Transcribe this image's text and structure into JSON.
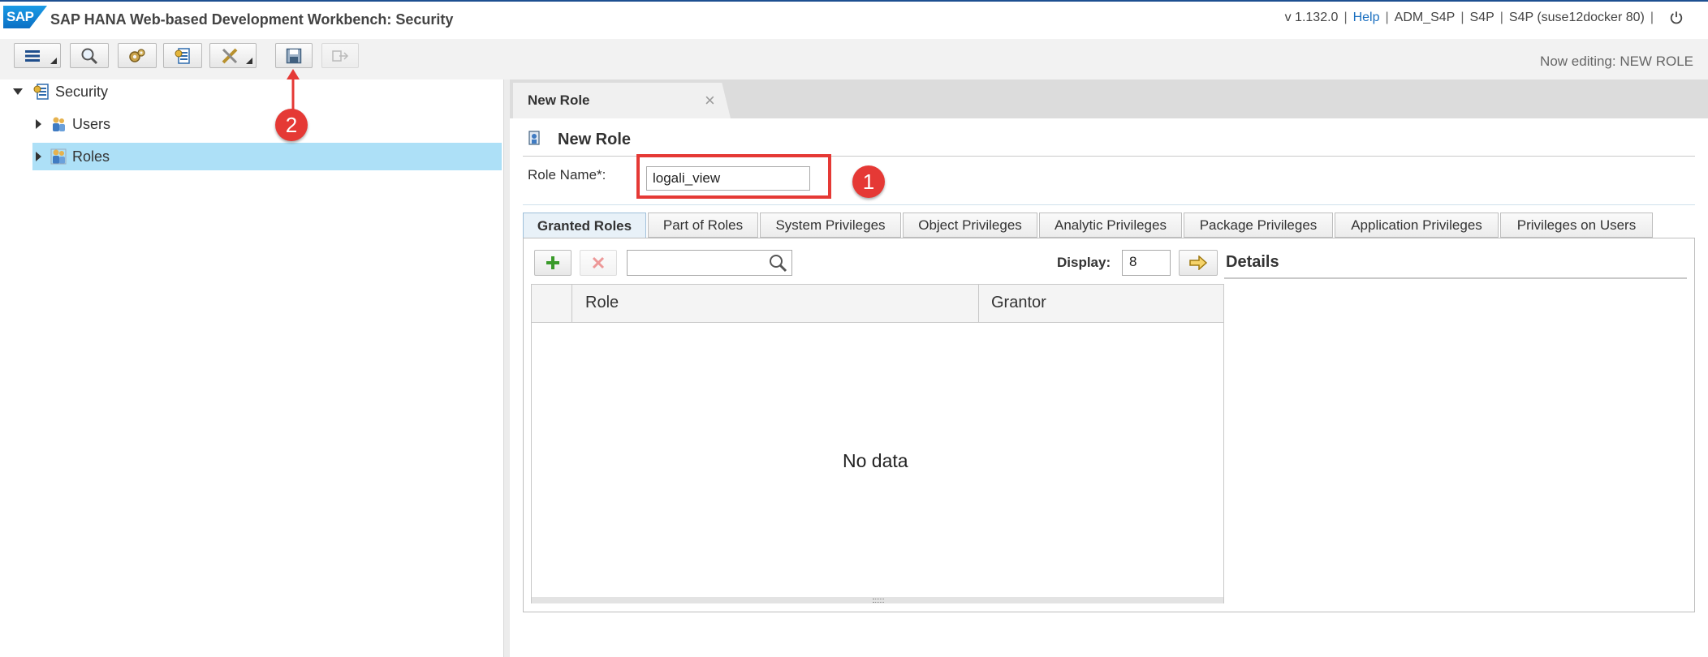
{
  "header": {
    "logo_text": "SAP",
    "title": "SAP HANA Web-based Development Workbench: Security",
    "version": "v 1.132.0",
    "help": "Help",
    "user": "ADM_S4P",
    "system": "S4P",
    "host": "S4P (suse12docker 80)"
  },
  "toolbar": {
    "now_editing": "Now editing: NEW ROLE",
    "buttons": [
      "menu-icon",
      "search-icon",
      "settings-icon",
      "catalog-icon",
      "tools-icon",
      "save-icon",
      "export-icon"
    ]
  },
  "tree": {
    "root": "Security",
    "items": [
      {
        "label": "Users"
      },
      {
        "label": "Roles",
        "selected": true
      }
    ]
  },
  "editor": {
    "tab_title": "New Role",
    "heading": "New Role",
    "role_name_label": "Role Name*:",
    "role_name_value": "logali_view",
    "tabs": [
      "Granted Roles",
      "Part of Roles",
      "System Privileges",
      "Object Privileges",
      "Analytic Privileges",
      "Package Privileges",
      "Application Privileges",
      "Privileges on Users"
    ],
    "display_label": "Display:",
    "display_value": "8",
    "columns": [
      "Role",
      "Grantor"
    ],
    "no_data": "No data",
    "details_title": "Details"
  },
  "annotations": {
    "badge_1": "1",
    "badge_2": "2",
    "highlight_color": "#e53935"
  },
  "colors": {
    "selected_row": "#ade0f7",
    "brand": "#0b6fc4"
  }
}
